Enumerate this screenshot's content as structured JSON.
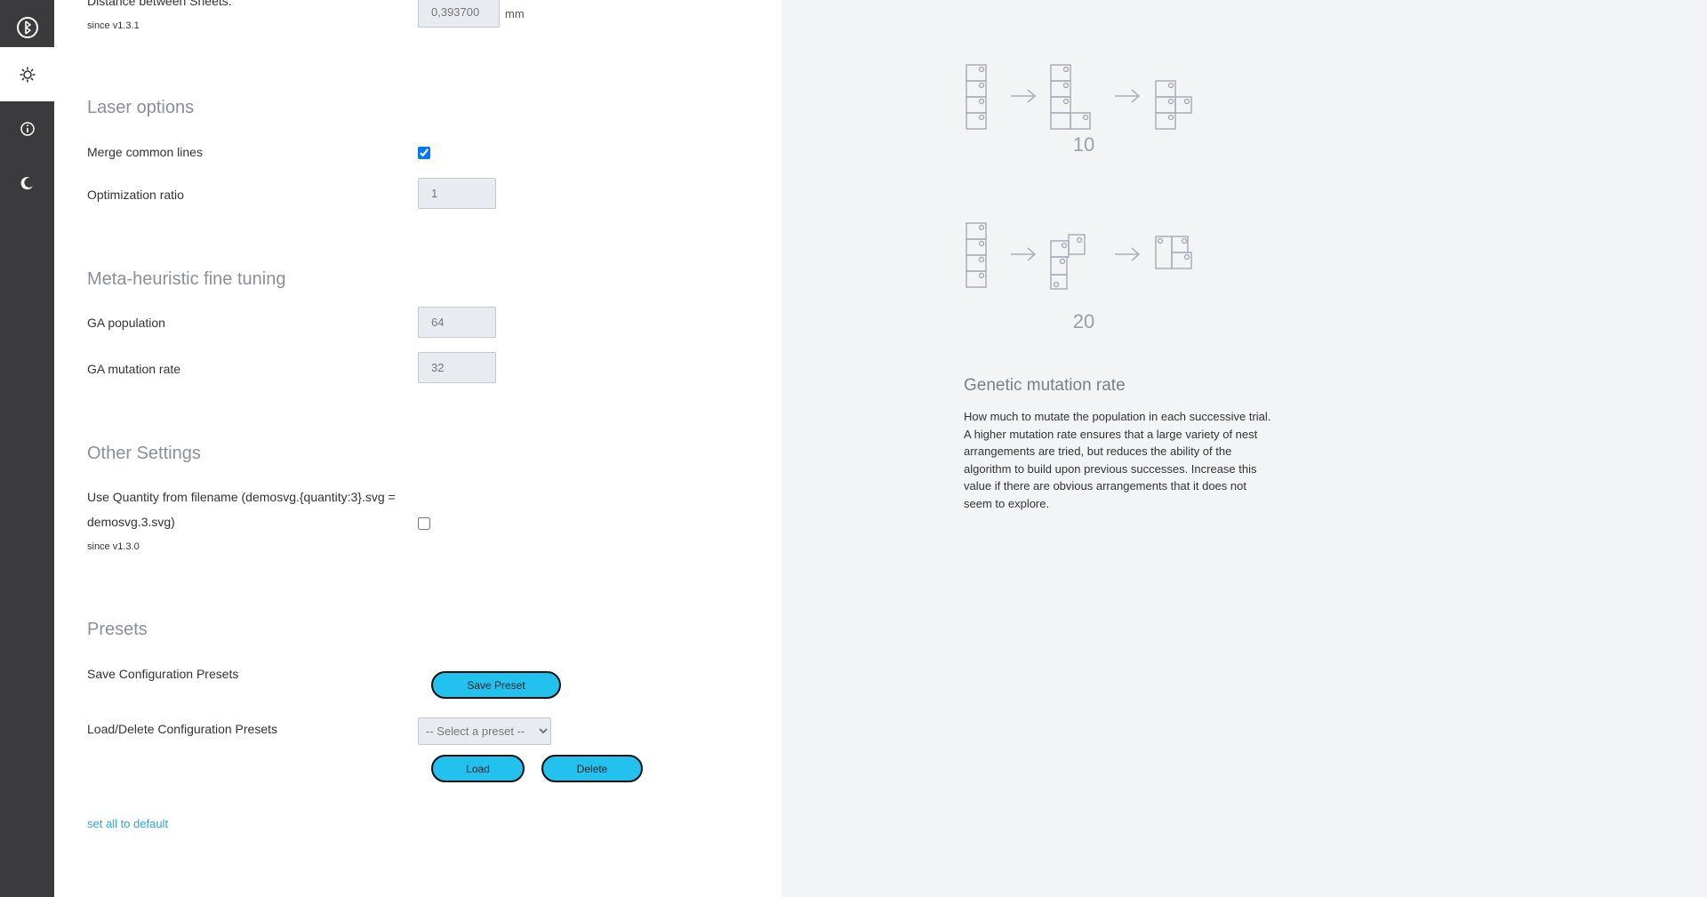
{
  "sidebar": {
    "items": [
      {
        "name": "home",
        "icon": "logo-icon",
        "active": false
      },
      {
        "name": "settings",
        "icon": "gear-icon",
        "active": true
      },
      {
        "name": "info",
        "icon": "info-icon",
        "active": false
      },
      {
        "name": "dark-mode",
        "icon": "moon-icon",
        "active": false
      }
    ]
  },
  "settings": {
    "sheet_distance": {
      "label": "Distance between Sheets:",
      "value": "0,393700",
      "unit": "mm",
      "since": "since v1.3.1"
    },
    "laser": {
      "title": "Laser options",
      "merge_label": "Merge common lines",
      "merge_checked": true,
      "ratio_label": "Optimization ratio",
      "ratio_value": "1"
    },
    "meta": {
      "title": "Meta-heuristic fine tuning",
      "population_label": "GA population",
      "population_value": "64",
      "mutation_label": "GA mutation rate",
      "mutation_value": "32"
    },
    "other": {
      "title": "Other Settings",
      "quantity_label_line1": "Use Quantity from filename (demosvg.{quantity:3}.svg =",
      "quantity_label_line2": "demosvg.3.svg)",
      "quantity_checked": false,
      "since": "since v1.3.0"
    },
    "presets": {
      "title": "Presets",
      "save_label": "Save Configuration Presets",
      "save_button": "Save Preset",
      "load_label": "Load/Delete Configuration Presets",
      "select_value": "-- Select a preset --",
      "load_button": "Load",
      "delete_button": "Delete"
    },
    "default_link": "set all to default"
  },
  "help": {
    "illustration_1_value": "10",
    "illustration_2_value": "20",
    "title": "Genetic mutation rate",
    "description": "How much to mutate the population in each successive trial. A higher mutation rate ensures that a large variety of nest arrangements are tried, but reduces the ability of the algorithm to build upon previous successes. Increase this value if there are obvious arrangements that it does not seem to explore."
  },
  "colors": {
    "sidebar_bg": "#3b3b3d",
    "accent_button": "#22c1ee",
    "link": "#2aa7dd",
    "panel_bg": "#f3f4f6"
  }
}
